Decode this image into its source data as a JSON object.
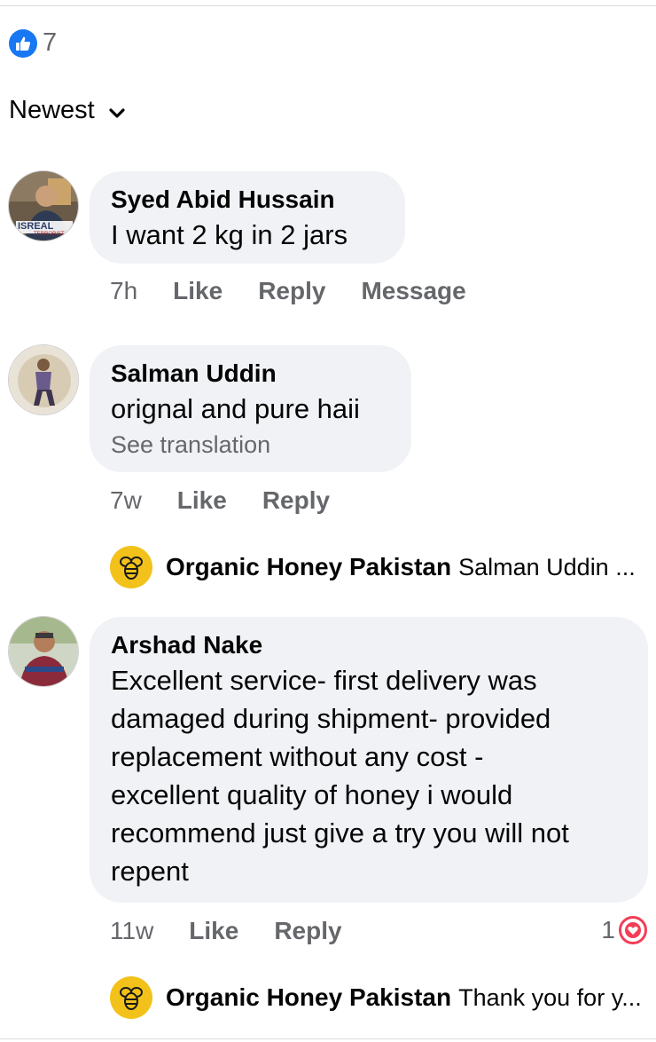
{
  "post": {
    "reaction_count": "7",
    "reaction_icon": "like-icon",
    "sort_label": "Newest"
  },
  "comments": [
    {
      "author": "Syed Abid Hussain",
      "text": "I want  2 kg in 2 jars",
      "time": "7h",
      "like": "Like",
      "reply": "Reply",
      "message": "Message",
      "avatar_caption": "ISREAL",
      "avatar_subcaption": "TERRORIST"
    },
    {
      "author": "Salman Uddin",
      "text": "orignal and pure haii",
      "see_translation": "See translation",
      "time": "7w",
      "like": "Like",
      "reply": "Reply",
      "reply_preview": {
        "author": "Organic Honey Pakistan",
        "text": "Salman Uddin ..."
      }
    },
    {
      "author": "Arshad Nake",
      "text_lines": [
        "Excellent service- first delivery was",
        "damaged during shipment- provided",
        "replacement without any cost -",
        "excellent quality of honey i would",
        "recommend just give a try you will not",
        "repent"
      ],
      "time": "11w",
      "like": "Like",
      "reply": "Reply",
      "reaction_count": "1",
      "reaction_icon": "love-icon",
      "reply_preview": {
        "author": "Organic Honey Pakistan",
        "text": "Thank you for y..."
      }
    }
  ],
  "colors": {
    "like_blue": "#1877f2",
    "bubble_bg": "#f0f2f5",
    "muted_text": "#65676b",
    "love_red": "#f33e58",
    "honey_yellow": "#f2c21b"
  }
}
